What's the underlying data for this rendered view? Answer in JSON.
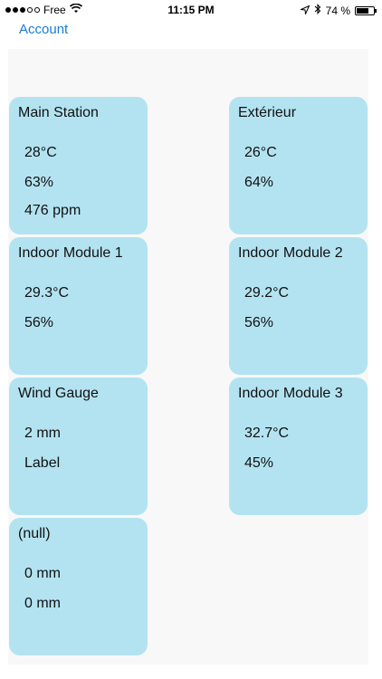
{
  "status_bar": {
    "carrier": "Free",
    "time": "11:15 PM",
    "battery_percent": "74 %",
    "battery_level": 0.74,
    "icons": [
      "signal-dots-icon",
      "wifi-icon",
      "location-icon",
      "bluetooth-icon",
      "battery-icon"
    ]
  },
  "nav": {
    "account_label": "Account",
    "accent_color": "#1a7bd6"
  },
  "tiles": [
    {
      "title": "Main Station",
      "values": [
        "28°C",
        "63%",
        "476 ppm"
      ]
    },
    {
      "title": "Extérieur",
      "values": [
        "26°C",
        "64%"
      ]
    },
    {
      "title": "Indoor Module 1",
      "values": [
        "29.3°C",
        "56%"
      ]
    },
    {
      "title": "Indoor Module 2",
      "values": [
        "29.2°C",
        "56%"
      ]
    },
    {
      "title": "Wind Gauge",
      "values": [
        "2 mm",
        "Label"
      ]
    },
    {
      "title": "Indoor Module 3",
      "values": [
        "32.7°C",
        "45%"
      ]
    },
    {
      "title": "(null)",
      "values": [
        "0 mm",
        "0 mm"
      ]
    }
  ],
  "colors": {
    "tile_background": "#b3e3f1",
    "content_background": "#f8f8f8"
  }
}
